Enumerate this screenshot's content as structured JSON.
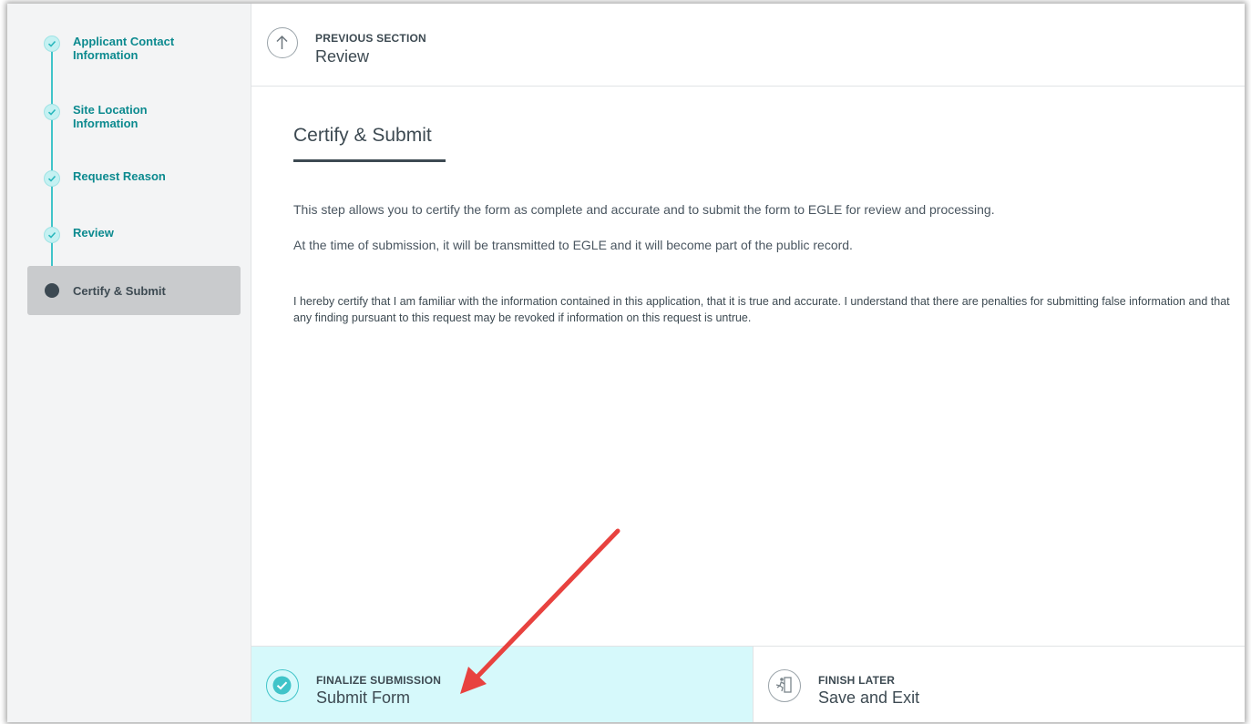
{
  "sidebar": {
    "steps": [
      {
        "label": "Applicant Contact Information",
        "state": "complete"
      },
      {
        "label": "Site Location Information",
        "state": "complete"
      },
      {
        "label": "Request Reason",
        "state": "complete"
      },
      {
        "label": "Review",
        "state": "complete"
      },
      {
        "label": "Certify & Submit",
        "state": "active"
      }
    ]
  },
  "nav": {
    "previous": {
      "caption": "PREVIOUS SECTION",
      "label": "Review",
      "icon": "arrow-up-icon"
    }
  },
  "main": {
    "title": "Certify & Submit",
    "paragraph1": "This step allows you to certify the form as complete and accurate and to submit the form to EGLE for review and processing.",
    "paragraph2": "At the time of submission, it will be transmitted to EGLE and it will become part of the public record.",
    "certification": "I hereby certify that I am familiar with the information contained in this application, that it is true and accurate. I understand that there are penalties for submitting false information and that any finding pursuant to this request may be revoked if information on this request is untrue."
  },
  "footer": {
    "finalize": {
      "caption": "FINALIZE SUBMISSION",
      "label": "Submit Form",
      "icon": "checkmark-icon"
    },
    "finish_later": {
      "caption": "FINISH LATER",
      "label": "Save and Exit",
      "icon": "exit-run-icon"
    }
  },
  "colors": {
    "accent": "#40c4c9",
    "accent_text": "#0c8a8f",
    "text_dark": "#3d4a52",
    "finalize_bg": "#d6f9fb",
    "annotation_arrow": "#e8423f"
  }
}
